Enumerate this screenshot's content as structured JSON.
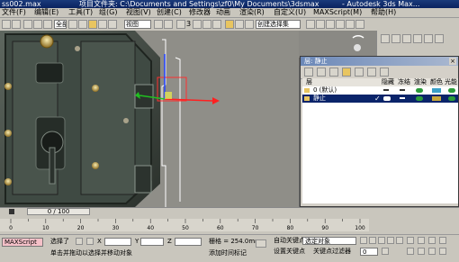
{
  "titlebar": {
    "file": "ss002.max",
    "project": "项目文件夹: C:\\Documents and Settings\\zf0\\My Documents\\3dsmax",
    "app": "- Autodesk 3ds Max..."
  },
  "menu": [
    "文件(F)",
    "编辑(E)",
    "工具(T)",
    "组(G)",
    "视图(V)",
    "创建(C)",
    "修改器",
    "动画",
    "渲染(R)",
    "自定义(U)",
    "MAXScript(M)",
    "帮助(H)"
  ],
  "toolbar": {
    "filter_select": "全部",
    "view_select": "视图",
    "selection_set": "创建选择集",
    "number": "3"
  },
  "layer_dialog": {
    "title": "层: 静止",
    "columns": [
      "层",
      "隐藏",
      "冻结",
      "渲染",
      "颜色",
      "光能"
    ],
    "rows": [
      {
        "name": "0 (默认)",
        "selected": false
      },
      {
        "name": "静止",
        "selected": true
      }
    ]
  },
  "timeline": {
    "slider_label": "0 / 100",
    "ticks": [
      "0",
      "10",
      "20",
      "30",
      "40",
      "50",
      "60",
      "70",
      "80",
      "90",
      "100"
    ]
  },
  "status": {
    "selected": "选择了",
    "x_label": "X",
    "y_label": "Y",
    "z_label": "Z",
    "grid": "栅格 = 254.0mm",
    "autokey": "自动关键点",
    "setkey": "设置关键点",
    "selected_object": "选定对象",
    "keyfilter": "关键点过滤器",
    "prompt": "单击并拖动以选择并移动对象",
    "add_time_tag": "添加时间标记",
    "script_label": "MAXScript",
    "frame": "0"
  }
}
